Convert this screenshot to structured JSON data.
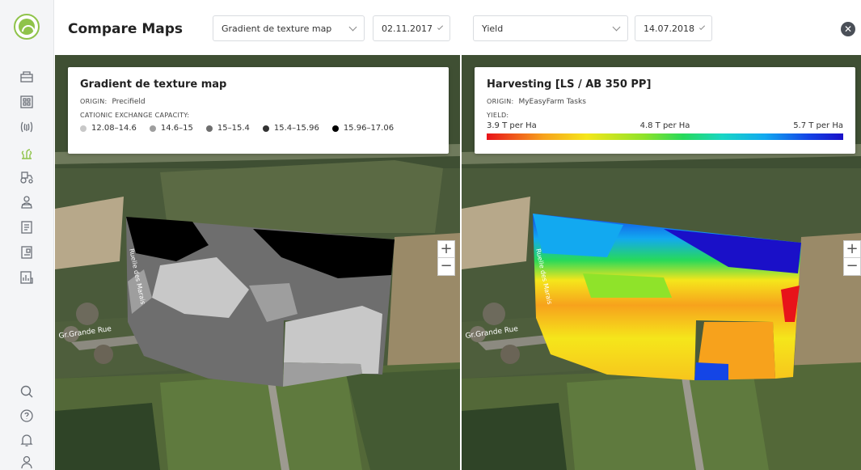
{
  "header": {
    "title": "Compare Maps",
    "left": {
      "layer_select": "Gradient de texture map",
      "date_select": "02.11.2017"
    },
    "right": {
      "layer_select": "Yield",
      "date_select": "14.07.2018"
    },
    "close_icon": "close-icon"
  },
  "sidebar": {
    "icons": [
      "app-logo",
      "satellite-map-icon",
      "grid-map-icon",
      "sensor-icon",
      "crop-map-icon",
      "tractor-icon",
      "user-group-icon",
      "notes-icon",
      "document-icon",
      "chart-icon",
      "search-icon",
      "help-icon",
      "bell-icon",
      "profile-icon"
    ],
    "active_color": "#8fc34a"
  },
  "left_map": {
    "legend": {
      "title": "Gradient de texture map",
      "origin_key": "ORIGIN:",
      "origin_value": "Precifield",
      "subtitle": "CATIONIC EXCHANGE CAPACITY:",
      "items": [
        {
          "label": "12.08–14.6",
          "color": "#c8c8c8"
        },
        {
          "label": "14.6–15",
          "color": "#9e9e9e"
        },
        {
          "label": "15–15.4",
          "color": "#6e6e6e"
        },
        {
          "label": "15.4–15.96",
          "color": "#333333"
        },
        {
          "label": "15.96–17.06",
          "color": "#000000"
        }
      ]
    },
    "place_labels": {
      "street_1": "Ruelle des Marais",
      "street_2": "Gr.Grande Rue"
    },
    "zoom_in": "+",
    "zoom_out": "−"
  },
  "right_map": {
    "legend": {
      "title": "Harvesting [LS / AB 350 PP]",
      "origin_key": "ORIGIN:",
      "origin_value": "MyEasyFarm Tasks",
      "subtitle": "YIELD:",
      "min_label": "3.9 T per Ha",
      "mid_label": "4.8 T per Ha",
      "max_label": "5.7 T per Ha"
    },
    "place_labels": {
      "street_1": "Ruelle des Marais",
      "street_2": "Gr.Grande Rue"
    },
    "zoom_in": "+",
    "zoom_out": "−"
  }
}
